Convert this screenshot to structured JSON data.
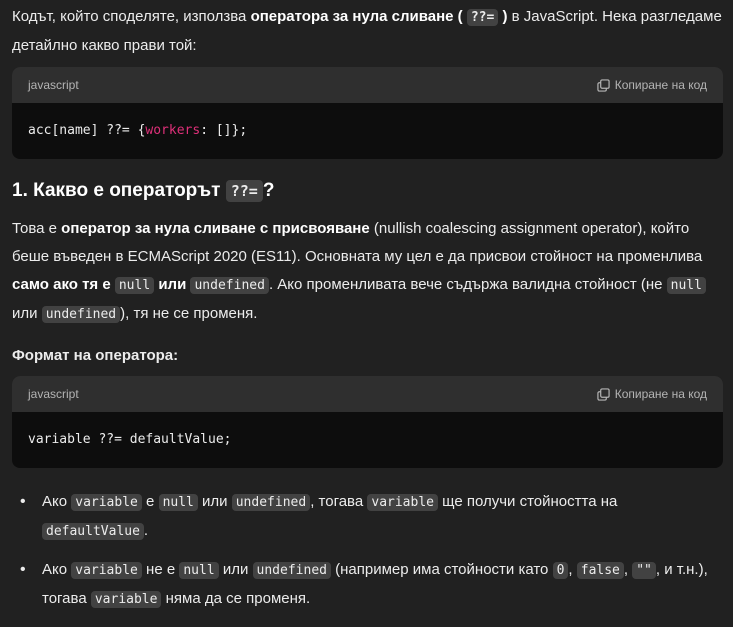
{
  "intro": {
    "t1": "Кодът, който споделяте, използва ",
    "b1": "оператора за нула сливане (",
    "c1": "??=",
    "b2": ")",
    "t2": " в JavaScript. Нека разгледаме детайлно какво прави той:"
  },
  "code1": {
    "lang": "javascript",
    "copy_label": "Копиране на код",
    "p1": "acc[name] ??= {",
    "kw": "workers",
    "p2": ": []};"
  },
  "heading": {
    "pre": "1. Какво е операторът ",
    "code": "??=",
    "post": "?"
  },
  "para": {
    "t1": "Това е ",
    "b1": "оператор за нула сливане с присвояване",
    "t2": " (nullish coalescing assignment operator), който беше въведен в ECMAScript 2020 (ES11). Основната му цел е да присвои стойност на променлива ",
    "b2": "само ако тя е ",
    "c1": "null",
    "b3": " или ",
    "c2": "undefined",
    "t3": ". Ако променливата вече съдържа валидна стойност (не ",
    "c3": "null",
    "t4": " или ",
    "c4": "undefined",
    "t5": "), тя не се променя."
  },
  "format_label": "Формат на оператора:",
  "code2": {
    "lang": "javascript",
    "copy_label": "Копиране на код",
    "code": "variable ??= defaultValue;"
  },
  "bullets": {
    "b1": {
      "t1": "Ако ",
      "c1": "variable",
      "t2": " е ",
      "c2": "null",
      "t3": " или ",
      "c3": "undefined",
      "t4": ", тогава ",
      "c4": "variable",
      "t5": " ще получи стойността на ",
      "c5": "defaultValue",
      "t6": "."
    },
    "b2": {
      "t1": "Ако ",
      "c1": "variable",
      "t2": " не е ",
      "c2": "null",
      "t3": " или ",
      "c3": "undefined",
      "t4": " (например има стойности като ",
      "c4": "0",
      "t5": ", ",
      "c5": "false",
      "t6": ", ",
      "c6": "\"\"",
      "t7": ", и т.н.), тогава ",
      "c7": "variable",
      "t8": " няма да се променя."
    }
  }
}
